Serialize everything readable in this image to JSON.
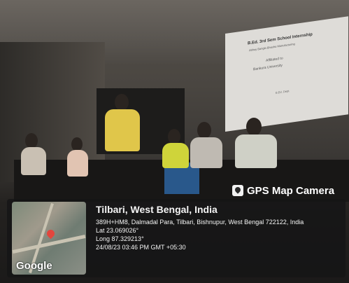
{
  "overlay": {
    "camera_label": "GPS Map Camera",
    "place": "Tilbari, West Bengal, India",
    "address": "389H+HM8, Dalmadal Para, Tilbari, Bishnupur, West Bengal 722122, India",
    "lat": "Lat 23.069026°",
    "long": "Long 87.329213°",
    "datetime": "24/08/23 03:46 PM GMT +05:30",
    "map_brand": "Google"
  },
  "screen": {
    "line1": "B.Ed. 3rd Sem School Internship",
    "line2": "Abhay Bangla Bhasha Manufacturing",
    "line3": "Affiliated to",
    "line4": "Bankura University",
    "line5": "B.Ed. Dept."
  }
}
